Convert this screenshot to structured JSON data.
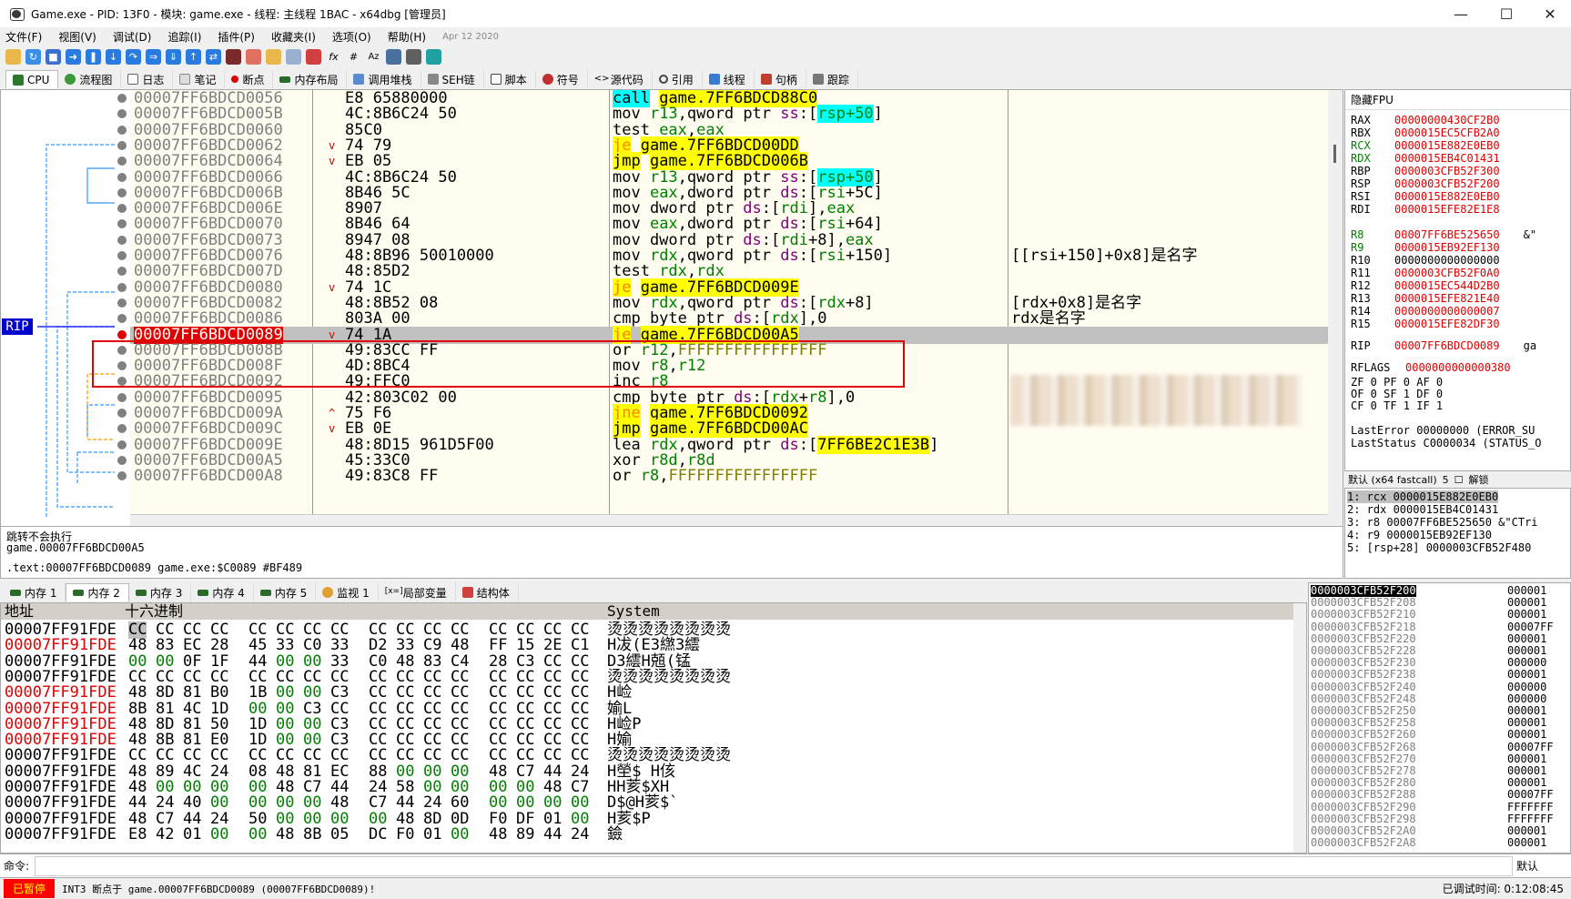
{
  "title": "Game.exe - PID: 13F0 - 模块: game.exe - 线程: 主线程 1BAC - x64dbg [管理员]",
  "menu": [
    "文件(F)",
    "视图(V)",
    "调试(D)",
    "追踪(I)",
    "插件(P)",
    "收藏夹(I)",
    "选项(O)",
    "帮助(H)"
  ],
  "menu_date": "Apr 12 2020",
  "tabs": [
    "CPU",
    "流程图",
    "日志",
    "笔记",
    "断点",
    "内存布局",
    "调用堆栈",
    "SEH链",
    "脚本",
    "符号",
    "源代码",
    "引用",
    "线程",
    "句柄",
    "跟踪"
  ],
  "disasm": [
    {
      "addr": "00007FF6BDCD0056",
      "arrow": "",
      "bytes": "E8 65880000",
      "instr": [
        [
          "call",
          "kw-call"
        ],
        [
          " ",
          ""
        ],
        [
          "game.7FF6BDCD88C0",
          "yel"
        ]
      ],
      "cmt": ""
    },
    {
      "addr": "00007FF6BDCD005B",
      "arrow": "",
      "bytes": "4C:8B6C24 50",
      "instr": [
        [
          "mov ",
          ""
        ],
        [
          "r13",
          "reg"
        ],
        [
          ",qword ptr ",
          ""
        ],
        [
          "ss",
          "seg"
        ],
        [
          ":",
          ""
        ],
        [
          "[",
          ""
        ],
        [
          "rsp+50",
          "reg cyanbox"
        ],
        [
          "]",
          ""
        ]
      ],
      "cmt": ""
    },
    {
      "addr": "00007FF6BDCD0060",
      "arrow": "",
      "bytes": "85C0",
      "instr": [
        [
          "test ",
          ""
        ],
        [
          "eax",
          "reg"
        ],
        [
          ",",
          ""
        ],
        [
          "eax",
          "reg"
        ]
      ],
      "cmt": ""
    },
    {
      "addr": "00007FF6BDCD0062",
      "arrow": "v",
      "bytes": "74 79",
      "instr": [
        [
          "je",
          "kw-jmp orange"
        ],
        [
          " ",
          ""
        ],
        [
          "game.7FF6BDCD00DD",
          "yel"
        ]
      ],
      "cmt": ""
    },
    {
      "addr": "00007FF6BDCD0064",
      "arrow": "v",
      "bytes": "EB 05",
      "instr": [
        [
          "jmp",
          "kw-jmp"
        ],
        [
          " ",
          ""
        ],
        [
          "game.7FF6BDCD006B",
          "yel"
        ]
      ],
      "cmt": ""
    },
    {
      "addr": "00007FF6BDCD0066",
      "arrow": "",
      "bytes": "4C:8B6C24 50",
      "instr": [
        [
          "mov ",
          ""
        ],
        [
          "r13",
          "reg"
        ],
        [
          ",qword ptr ",
          ""
        ],
        [
          "ss",
          "seg"
        ],
        [
          ":",
          ""
        ],
        [
          "[",
          ""
        ],
        [
          "rsp+50",
          "reg cyanbox"
        ],
        [
          "]",
          ""
        ]
      ],
      "cmt": ""
    },
    {
      "addr": "00007FF6BDCD006B",
      "arrow": "",
      "bytes": "8B46 5C",
      "instr": [
        [
          "mov ",
          ""
        ],
        [
          "eax",
          "reg"
        ],
        [
          ",dword ptr ",
          ""
        ],
        [
          "ds",
          "seg"
        ],
        [
          ":[",
          ""
        ],
        [
          "rsi",
          "reg"
        ],
        [
          "+5C]",
          ""
        ]
      ],
      "cmt": ""
    },
    {
      "addr": "00007FF6BDCD006E",
      "arrow": "",
      "bytes": "8907",
      "instr": [
        [
          "mov dword ptr ",
          ""
        ],
        [
          "ds",
          "seg"
        ],
        [
          ":[",
          ""
        ],
        [
          "rdi",
          "reg"
        ],
        [
          "],",
          ""
        ],
        [
          "eax",
          "reg"
        ]
      ],
      "cmt": ""
    },
    {
      "addr": "00007FF6BDCD0070",
      "arrow": "",
      "bytes": "8B46 64",
      "instr": [
        [
          "mov ",
          ""
        ],
        [
          "eax",
          "reg"
        ],
        [
          ",dword ptr ",
          ""
        ],
        [
          "ds",
          "seg"
        ],
        [
          ":[",
          ""
        ],
        [
          "rsi",
          "reg"
        ],
        [
          "+64]",
          ""
        ]
      ],
      "cmt": ""
    },
    {
      "addr": "00007FF6BDCD0073",
      "arrow": "",
      "bytes": "8947 08",
      "instr": [
        [
          "mov dword ptr ",
          ""
        ],
        [
          "ds",
          "seg"
        ],
        [
          ":[",
          ""
        ],
        [
          "rdi",
          "reg"
        ],
        [
          "+8],",
          ""
        ],
        [
          "eax",
          "reg"
        ]
      ],
      "cmt": ""
    },
    {
      "addr": "00007FF6BDCD0076",
      "arrow": "",
      "bytes": "48:8B96 50010000",
      "instr": [
        [
          "mov ",
          ""
        ],
        [
          "rdx",
          "reg"
        ],
        [
          ",qword ptr ",
          ""
        ],
        [
          "ds",
          "seg"
        ],
        [
          ":[",
          ""
        ],
        [
          "rsi",
          "reg"
        ],
        [
          "+150]",
          ""
        ]
      ],
      "cmt": "[[rsi+150]+0x8]是名字"
    },
    {
      "addr": "00007FF6BDCD007D",
      "arrow": "",
      "bytes": "48:85D2",
      "instr": [
        [
          "test ",
          ""
        ],
        [
          "rdx",
          "reg"
        ],
        [
          ",",
          ""
        ],
        [
          "rdx",
          "reg"
        ]
      ],
      "cmt": ""
    },
    {
      "addr": "00007FF6BDCD0080",
      "arrow": "v",
      "bytes": "74 1C",
      "instr": [
        [
          "je",
          "kw-jmp orange"
        ],
        [
          " ",
          ""
        ],
        [
          "game.7FF6BDCD009E",
          "yel"
        ]
      ],
      "cmt": ""
    },
    {
      "addr": "00007FF6BDCD0082",
      "arrow": "",
      "bytes": "48:8B52 08",
      "instr": [
        [
          "mov ",
          ""
        ],
        [
          "rdx",
          "reg"
        ],
        [
          ",qword ptr ",
          ""
        ],
        [
          "ds",
          "seg"
        ],
        [
          ":[",
          ""
        ],
        [
          "rdx",
          "reg"
        ],
        [
          "+8]",
          ""
        ]
      ],
      "cmt": "[rdx+0x8]是名字"
    },
    {
      "addr": "00007FF6BDCD0086",
      "arrow": "",
      "bytes": "803A 00",
      "instr": [
        [
          "cmp byte ptr ",
          ""
        ],
        [
          "ds",
          "seg"
        ],
        [
          ":[",
          ""
        ],
        [
          "rdx",
          "reg"
        ],
        [
          "],0",
          ""
        ]
      ],
      "cmt": "rdx是名字"
    },
    {
      "addr": "00007FF6BDCD0089",
      "arrow": "v",
      "bytes": "74 1A",
      "instr": [
        [
          "je",
          "kw-jmp orange"
        ],
        [
          " ",
          ""
        ],
        [
          "game.7FF6BDCD00A5",
          "yel"
        ]
      ],
      "cmt": "",
      "rip": true
    },
    {
      "addr": "00007FF6BDCD008B",
      "arrow": "",
      "bytes": "49:83CC FF",
      "instr": [
        [
          "or ",
          ""
        ],
        [
          "r12",
          "reg"
        ],
        [
          ",",
          ""
        ],
        [
          "FFFFFFFFFFFFFFFF",
          "imm"
        ]
      ],
      "cmt": ""
    },
    {
      "addr": "00007FF6BDCD008F",
      "arrow": "",
      "bytes": "4D:8BC4",
      "instr": [
        [
          "mov ",
          ""
        ],
        [
          "r8",
          "reg"
        ],
        [
          ",",
          ""
        ],
        [
          "r12",
          "reg"
        ]
      ],
      "cmt": ""
    },
    {
      "addr": "00007FF6BDCD0092",
      "arrow": "",
      "bytes": "49:FFC0",
      "instr": [
        [
          "inc ",
          ""
        ],
        [
          "r8",
          "reg"
        ]
      ],
      "cmt": ""
    },
    {
      "addr": "00007FF6BDCD0095",
      "arrow": "",
      "bytes": "42:803C02 00",
      "instr": [
        [
          "cmp byte ptr ",
          ""
        ],
        [
          "ds",
          "seg"
        ],
        [
          ":[",
          ""
        ],
        [
          "rdx",
          "reg"
        ],
        [
          "+",
          ""
        ],
        [
          "r8",
          "reg"
        ],
        [
          "],0",
          ""
        ]
      ],
      "cmt": ""
    },
    {
      "addr": "00007FF6BDCD009A",
      "arrow": "^",
      "bytes": "75 F6",
      "instr": [
        [
          "jne",
          "kw-jmp orange"
        ],
        [
          " ",
          ""
        ],
        [
          "game.7FF6BDCD0092",
          "yel"
        ]
      ],
      "cmt": ""
    },
    {
      "addr": "00007FF6BDCD009C",
      "arrow": "v",
      "bytes": "EB 0E",
      "instr": [
        [
          "jmp",
          "kw-jmp"
        ],
        [
          " ",
          ""
        ],
        [
          "game.7FF6BDCD00AC",
          "yel"
        ]
      ],
      "cmt": ""
    },
    {
      "addr": "00007FF6BDCD009E",
      "arrow": "",
      "bytes": "48:8D15 961D5F00",
      "instr": [
        [
          "lea ",
          ""
        ],
        [
          "rdx",
          "reg"
        ],
        [
          ",qword ptr ",
          ""
        ],
        [
          "ds",
          "seg"
        ],
        [
          ":[",
          ""
        ],
        [
          "7FF6BE2C1E3B",
          "yel"
        ],
        [
          "]",
          ""
        ]
      ],
      "cmt": ""
    },
    {
      "addr": "00007FF6BDCD00A5",
      "arrow": "",
      "bytes": "45:33C0",
      "instr": [
        [
          "xor ",
          ""
        ],
        [
          "r8d",
          "reg"
        ],
        [
          ",",
          ""
        ],
        [
          "r8d",
          "reg"
        ]
      ],
      "cmt": ""
    },
    {
      "addr": "00007FF6BDCD00A8",
      "arrow": "",
      "bytes": "49:83C8 FF",
      "instr": [
        [
          "or ",
          ""
        ],
        [
          "r8",
          "reg"
        ],
        [
          ",",
          ""
        ],
        [
          "FFFFFFFFFFFFFFFF",
          "imm"
        ]
      ],
      "cmt": ""
    }
  ],
  "rip_label": "RIP",
  "info": [
    "跳转不会执行",
    "game.00007FF6BDCD00A5",
    ".text:00007FF6BDCD0089 game.exe:$C0089 #BF489"
  ],
  "regs_header": "隐藏FPU",
  "regs": [
    {
      "n": "RAX",
      "v": "00000000430CF2B0"
    },
    {
      "n": "RBX",
      "v": "0000015EC5CFB2A0"
    },
    {
      "n": "RCX",
      "v": "0000015E882E0EB0",
      "g": true
    },
    {
      "n": "RDX",
      "v": "0000015EB4C01431",
      "g": true
    },
    {
      "n": "RBP",
      "v": "0000003CFB52F300"
    },
    {
      "n": "RSP",
      "v": "0000003CFB52F200"
    },
    {
      "n": "RSI",
      "v": "0000015E882E0EB0"
    },
    {
      "n": "RDI",
      "v": "0000015EFE82E1E8"
    },
    {
      "n": "R8",
      "v": "00007FF6BE525650",
      "g": true,
      "x": "&\""
    },
    {
      "n": "R9",
      "v": "0000015EB92EF130",
      "g": true
    },
    {
      "n": "R10",
      "v": "0000000000000000",
      "b": true
    },
    {
      "n": "R11",
      "v": "0000003CFB52F0A0"
    },
    {
      "n": "R12",
      "v": "0000015EC544D2B0"
    },
    {
      "n": "R13",
      "v": "0000015EFE821E40"
    },
    {
      "n": "R14",
      "v": "0000000000000007"
    },
    {
      "n": "R15",
      "v": "0000015EFE82DF30"
    },
    {
      "n": "RIP",
      "v": "00007FF6BDCD0089",
      "x": "ga"
    },
    {
      "n": "RFLAGS",
      "v": "0000000000000380"
    }
  ],
  "flags": [
    "ZF 0  PF 0  AF 0",
    "OF 0  SF 1  DF 0",
    "CF 0  TF 1  IF 1"
  ],
  "last_error": "LastError  00000000 (ERROR_SU",
  "last_status": "LastStatus C0000034 (STATUS_O",
  "args_bar": {
    "conv": "默认 (x64 fastcall)",
    "count": "5",
    "unlock": "解锁"
  },
  "args": [
    "1: rcx 0000015E882E0EB0",
    "2: rdx 0000015EB4C01431",
    "3: r8 00007FF6BE525650 &\"CTri",
    "4: r9 0000015EB92EF130",
    "5: [rsp+28] 0000003CFB52F480"
  ],
  "memtabs": [
    "内存 1",
    "内存 2",
    "内存 3",
    "内存 4",
    "内存 5",
    "监视 1",
    "局部变量",
    "结构体"
  ],
  "dump_header": {
    "addr": "地址",
    "hex": "十六进制",
    "ascii": "System"
  },
  "dump": [
    {
      "a": "00007FF91FDE",
      "red": false,
      "h": [
        "CC",
        "CC",
        "CC",
        "CC",
        "CC",
        "CC",
        "CC",
        "CC",
        "CC",
        "CC",
        "CC",
        "CC",
        "CC",
        "CC",
        "CC",
        "CC"
      ],
      "s": "烫烫烫烫烫烫烫烫"
    },
    {
      "a": "00007FF91FDE",
      "red": true,
      "h": [
        "48",
        "83",
        "EC",
        "28",
        "45",
        "33",
        "C0",
        "33",
        "D2",
        "33",
        "C9",
        "48",
        "FF",
        "15",
        "2E",
        "C1"
      ],
      "s": "H冹(E3繺3繧"
    },
    {
      "a": "00007FF91FDE",
      "red": false,
      "h": [
        "00",
        "00",
        "0F",
        "1F",
        "44",
        "00",
        "00",
        "33",
        "C0",
        "48",
        "83",
        "C4",
        "28",
        "C3",
        "CC",
        "CC"
      ],
      "s": "D3繧H兡(锰"
    },
    {
      "a": "00007FF91FDE",
      "red": false,
      "h": [
        "CC",
        "CC",
        "CC",
        "CC",
        "CC",
        "CC",
        "CC",
        "CC",
        "CC",
        "CC",
        "CC",
        "CC",
        "CC",
        "CC",
        "CC",
        "CC"
      ],
      "s": "烫烫烫烫烫烫烫烫"
    },
    {
      "a": "00007FF91FDE",
      "red": true,
      "h": [
        "48",
        "8D",
        "81",
        "B0",
        "1B",
        "00",
        "00",
        "C3",
        "CC",
        "CC",
        "CC",
        "CC",
        "CC",
        "CC",
        "CC",
        "CC"
      ],
      "s": "H崄"
    },
    {
      "a": "00007FF91FDE",
      "red": true,
      "h": [
        "8B",
        "81",
        "4C",
        "1D",
        "00",
        "00",
        "C3",
        "CC",
        "CC",
        "CC",
        "CC",
        "CC",
        "CC",
        "CC",
        "CC",
        "CC"
      ],
      "s": "媮L"
    },
    {
      "a": "00007FF91FDE",
      "red": true,
      "h": [
        "48",
        "8D",
        "81",
        "50",
        "1D",
        "00",
        "00",
        "C3",
        "CC",
        "CC",
        "CC",
        "CC",
        "CC",
        "CC",
        "CC",
        "CC"
      ],
      "s": "H崄P"
    },
    {
      "a": "00007FF91FDE",
      "red": true,
      "h": [
        "48",
        "8B",
        "81",
        "E0",
        "1D",
        "00",
        "00",
        "C3",
        "CC",
        "CC",
        "CC",
        "CC",
        "CC",
        "CC",
        "CC",
        "CC"
      ],
      "s": "H媮"
    },
    {
      "a": "00007FF91FDE",
      "red": false,
      "h": [
        "CC",
        "CC",
        "CC",
        "CC",
        "CC",
        "CC",
        "CC",
        "CC",
        "CC",
        "CC",
        "CC",
        "CC",
        "CC",
        "CC",
        "CC",
        "CC"
      ],
      "s": "烫烫烫烫烫烫烫烫"
    },
    {
      "a": "00007FF91FDE",
      "red": false,
      "h": [
        "48",
        "89",
        "4C",
        "24",
        "08",
        "48",
        "81",
        "EC",
        "88",
        "00",
        "00",
        "00",
        "48",
        "C7",
        "44",
        "24"
      ],
      "s": "H塋$ H侅"
    },
    {
      "a": "00007FF91FDE",
      "red": false,
      "h": [
        "48",
        "00",
        "00",
        "00",
        "00",
        "48",
        "C7",
        "44",
        "24",
        "58",
        "00",
        "00",
        "00",
        "00",
        "48",
        "C7"
      ],
      "s": "HH荄$XH"
    },
    {
      "a": "00007FF91FDE",
      "red": false,
      "h": [
        "44",
        "24",
        "40",
        "00",
        "00",
        "00",
        "00",
        "48",
        "C7",
        "44",
        "24",
        "60",
        "00",
        "00",
        "00",
        "00"
      ],
      "s": "D$@H荄$`"
    },
    {
      "a": "00007FF91FDE",
      "red": false,
      "h": [
        "48",
        "C7",
        "44",
        "24",
        "50",
        "00",
        "00",
        "00",
        "00",
        "48",
        "8D",
        "0D",
        "F0",
        "DF",
        "01",
        "00"
      ],
      "s": "H荄$P"
    },
    {
      "a": "00007FF91FDE",
      "red": false,
      "h": [
        "E8",
        "42",
        "01",
        "00",
        "00",
        "48",
        "8B",
        "05",
        "DC",
        "F0",
        "01",
        "00",
        "48",
        "89",
        "44",
        "24"
      ],
      "s": "鐱"
    }
  ],
  "stack": [
    {
      "a": "0000003CFB52F200",
      "v": "000001",
      "sel": true
    },
    {
      "a": "0000003CFB52F208",
      "v": "000001"
    },
    {
      "a": "0000003CFB52F210",
      "v": "000001"
    },
    {
      "a": "0000003CFB52F218",
      "v": "00007FF"
    },
    {
      "a": "0000003CFB52F220",
      "v": "000001"
    },
    {
      "a": "0000003CFB52F228",
      "v": "000001"
    },
    {
      "a": "0000003CFB52F230",
      "v": "000000"
    },
    {
      "a": "0000003CFB52F238",
      "v": "000001"
    },
    {
      "a": "0000003CFB52F240",
      "v": "000000"
    },
    {
      "a": "0000003CFB52F248",
      "v": "000000"
    },
    {
      "a": "0000003CFB52F250",
      "v": "000001"
    },
    {
      "a": "0000003CFB52F258",
      "v": "000001"
    },
    {
      "a": "0000003CFB52F260",
      "v": "000001"
    },
    {
      "a": "0000003CFB52F268",
      "v": "00007FF"
    },
    {
      "a": "0000003CFB52F270",
      "v": "000001"
    },
    {
      "a": "0000003CFB52F278",
      "v": "000001"
    },
    {
      "a": "0000003CFB52F280",
      "v": "000001"
    },
    {
      "a": "0000003CFB52F288",
      "v": "00007FF"
    },
    {
      "a": "0000003CFB52F290",
      "v": "FFFFFFF"
    },
    {
      "a": "0000003CFB52F298",
      "v": "FFFFFFF"
    },
    {
      "a": "0000003CFB52F2A0",
      "v": "000001"
    },
    {
      "a": "0000003CFB52F2A8",
      "v": "000001"
    }
  ],
  "cmd": {
    "label": "命令:",
    "mode": "默认"
  },
  "status": {
    "paused": "已暂停",
    "msg": "INT3 断点于 game.00007FF6BDCD0089 (00007FF6BDCD0089)!",
    "time": "已调试时间:   0:12:08:45"
  }
}
